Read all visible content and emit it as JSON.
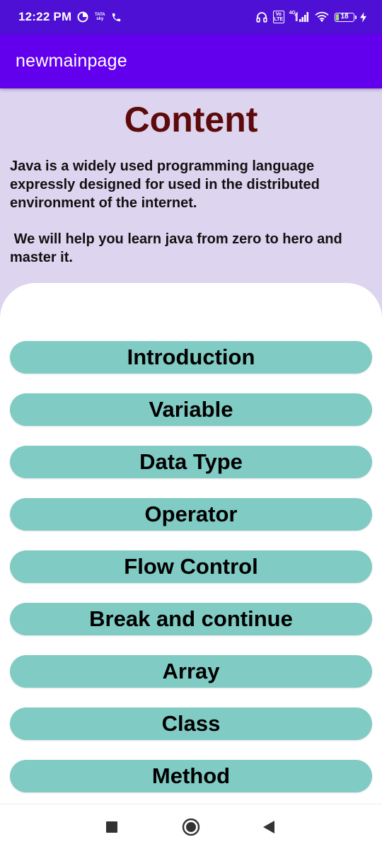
{
  "status_bar": {
    "time": "12:22 PM",
    "carrier_label": "TATA sky",
    "volte_label": "Vo LTE",
    "network_type": "4G",
    "battery": "18",
    "battery_level": 0.18,
    "icons": [
      "data-saver-icon",
      "tata-sky-icon",
      "phone-call-icon",
      "headphones-icon",
      "volte-icon",
      "signal-icon",
      "wifi-icon",
      "battery-icon",
      "charging-icon"
    ]
  },
  "app_bar": {
    "title": "newmainpage"
  },
  "header": {
    "title": "Content",
    "description_1": "Java is a widely used programming language expressly designed for used in the distributed environment of the internet.",
    "description_2": " We will help you learn java from zero to hero and master it."
  },
  "topics": [
    "Introduction",
    "Variable",
    "Data Type",
    "Operator",
    "Flow Control",
    "Break and continue",
    "Array",
    "Class",
    "Method"
  ],
  "nav_bar": {
    "icons": [
      "recents-square-icon",
      "home-circle-icon",
      "back-triangle-icon"
    ]
  },
  "colors": {
    "status_bar": "#4e10d4",
    "app_bar": "#6200ee",
    "page_background": "#ddd4ef",
    "title_text": "#5c0a0a",
    "button": "#80cbc4",
    "card": "#ffffff"
  }
}
